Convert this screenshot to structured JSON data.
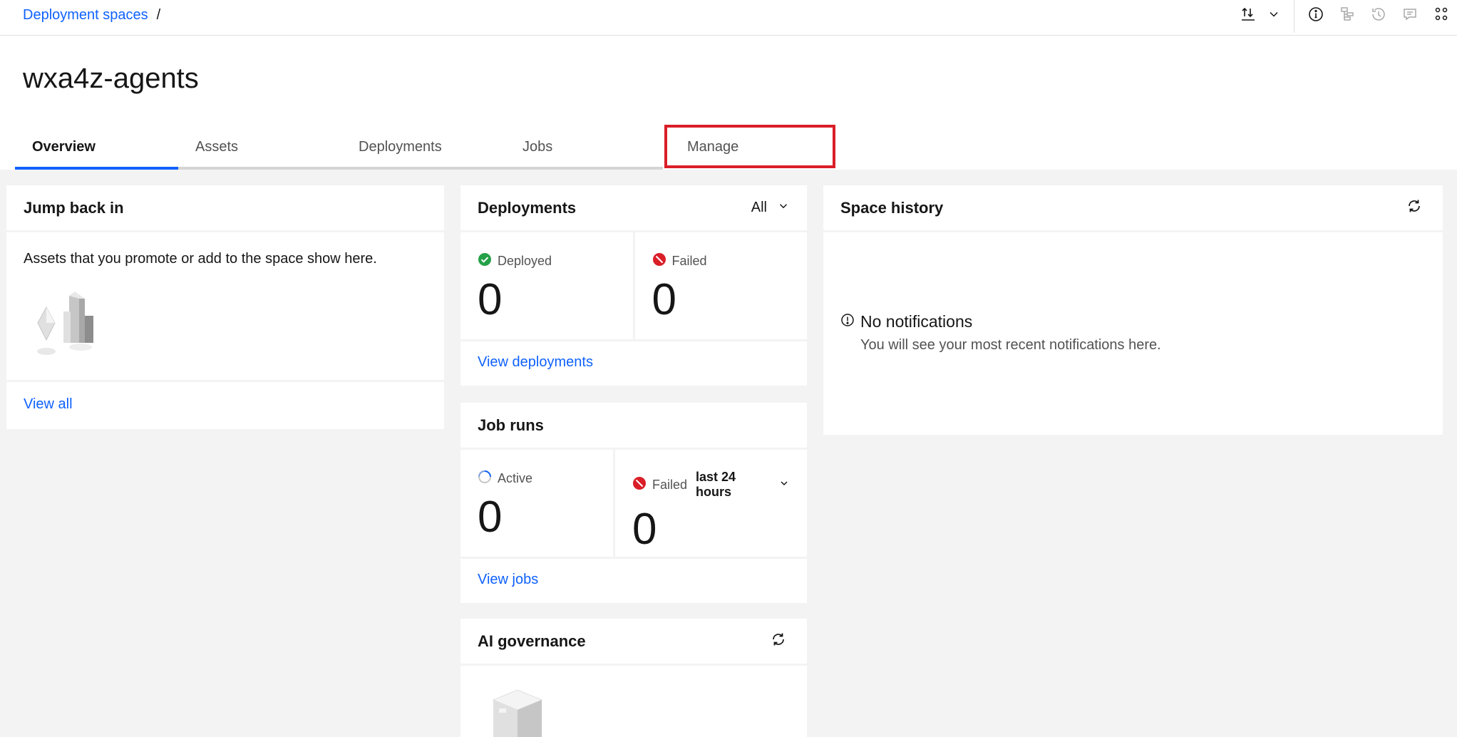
{
  "breadcrumb": {
    "link": "Deployment spaces",
    "separator": "/"
  },
  "toolbar": {
    "icons": [
      "import-export-icon",
      "chevron-down-icon",
      "info-icon",
      "lineage-icon",
      "history-icon",
      "comment-icon",
      "settings-adjust-icon"
    ]
  },
  "space": {
    "title": "wxa4z-agents"
  },
  "tabs": [
    {
      "label": "Overview",
      "active": true
    },
    {
      "label": "Assets",
      "active": false
    },
    {
      "label": "Deployments",
      "active": false
    },
    {
      "label": "Jobs",
      "active": false
    },
    {
      "label": "Manage",
      "active": false,
      "highlighted": true
    }
  ],
  "jump_back_in": {
    "title": "Jump back in",
    "description": "Assets that you promote or add to the space show here.",
    "view_all": "View all"
  },
  "deployments": {
    "title": "Deployments",
    "filter": "All",
    "deployed_label": "Deployed",
    "deployed_count": "0",
    "failed_label": "Failed",
    "failed_count": "0",
    "view_link": "View deployments"
  },
  "job_runs": {
    "title": "Job runs",
    "active_label": "Active",
    "active_count": "0",
    "failed_label": "Failed",
    "failed_period": "last 24 hours",
    "failed_count": "0",
    "view_link": "View jobs"
  },
  "ai_governance": {
    "title": "AI governance"
  },
  "space_history": {
    "title": "Space history",
    "empty_title": "No notifications",
    "empty_message": "You will see your most recent notifications here."
  },
  "colors": {
    "link": "#0f62fe",
    "success": "#24a148",
    "error": "#da1e28",
    "highlight": "#da1e28"
  }
}
